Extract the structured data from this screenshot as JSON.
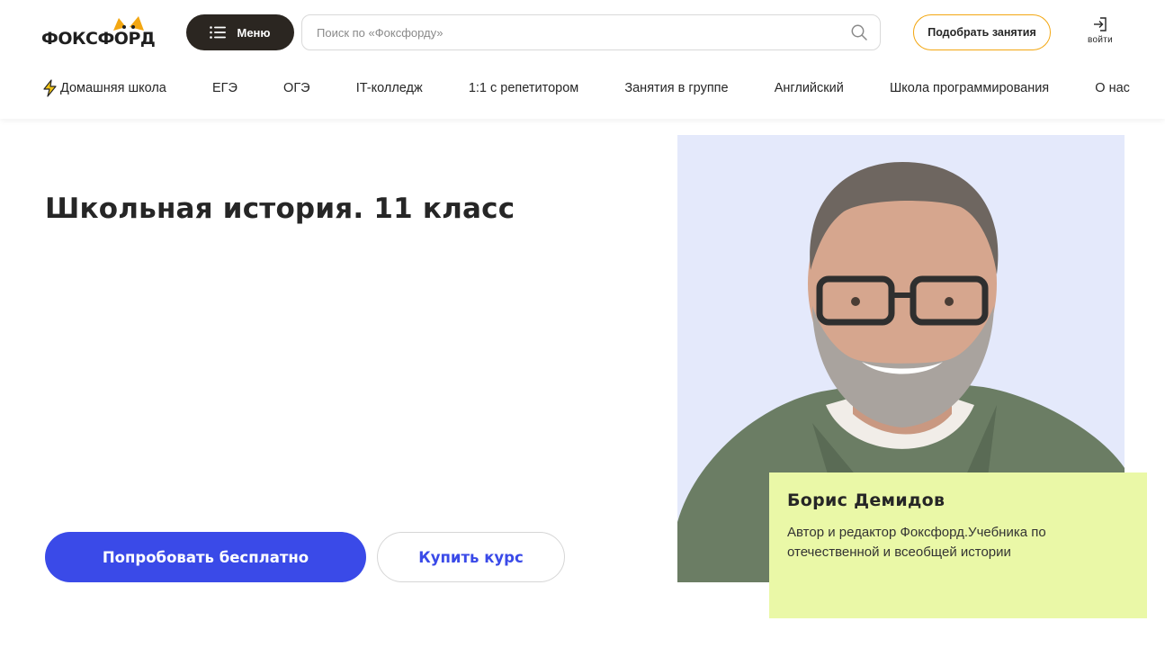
{
  "header": {
    "logo_text": "ФОКСФОРД",
    "menu_label": "Меню",
    "search_placeholder": "Поиск по «Фоксфорду»",
    "pick_button": "Подобрать занятия",
    "login_label": "войти"
  },
  "nav": {
    "items": [
      {
        "label": "Домашняя школа",
        "icon": "lightning-icon"
      },
      {
        "label": "ЕГЭ"
      },
      {
        "label": "ОГЭ"
      },
      {
        "label": "IT-колледж"
      },
      {
        "label": "1:1 с репетитором"
      },
      {
        "label": "Занятия в группе"
      },
      {
        "label": "Английский"
      },
      {
        "label": "Школа программирования"
      },
      {
        "label": "О нас"
      }
    ]
  },
  "main": {
    "title": "Школьная история. 11 класс",
    "try_button": "Попробовать бесплатно",
    "buy_button": "Купить курс"
  },
  "author": {
    "name": "Борис Демидов",
    "description": "Автор и редактор Фоксфорд.Учебника по отечественной и всеобщей истории"
  },
  "colors": {
    "accent": "#3a4ae8",
    "dark": "#2b2621",
    "orange": "#f3a712",
    "card_bg": "#eaf8a7",
    "photo_bg": "#e4e9fb"
  }
}
